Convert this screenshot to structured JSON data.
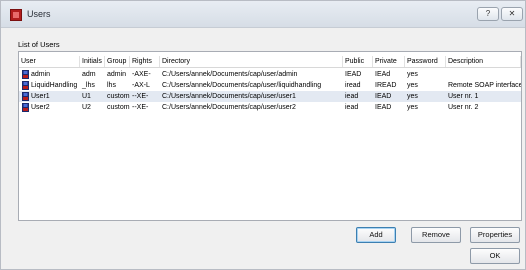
{
  "window": {
    "title": "Users",
    "help_glyph": "?",
    "close_glyph": "✕"
  },
  "list_label": "List of Users",
  "columns": [
    "User",
    "Initials",
    "Group",
    "Rights",
    "Directory",
    "Public",
    "Private",
    "Password",
    "Description"
  ],
  "rows": [
    {
      "user": "admin",
      "initials": "adm",
      "group": "admin",
      "rights": "-AXE-",
      "directory": "C:/Users/annek/Documents/cap/user/admin",
      "public": "IEAD",
      "private": "IEAd",
      "password": "yes",
      "description": ""
    },
    {
      "user": "LiquidHandling",
      "initials": "_lhs",
      "group": "lhs",
      "rights": "-AX-L",
      "directory": "C:/Users/annek/Documents/cap/user/liquidhandling",
      "public": "iread",
      "private": "IREAD",
      "password": "yes",
      "description": "Remote SOAP interface"
    },
    {
      "user": "User1",
      "initials": "U1",
      "group": "custom",
      "rights": "--XE-",
      "directory": "C:/Users/annek/Documents/cap/user/user1",
      "public": "iead",
      "private": "IEAD",
      "password": "yes",
      "description": "User nr. 1"
    },
    {
      "user": "User2",
      "initials": "U2",
      "group": "custom",
      "rights": "--XE-",
      "directory": "C:/Users/annek/Documents/cap/user/user2",
      "public": "iead",
      "private": "IEAD",
      "password": "yes",
      "description": "User nr. 2"
    }
  ],
  "selected_row": "User1",
  "buttons": {
    "add": "Add",
    "remove": "Remove",
    "properties": "Properties",
    "ok": "OK"
  },
  "icons": {
    "app": "app-icon",
    "user": "user-icon"
  },
  "colors": {
    "app_icon": "#b21d1d",
    "selection": "#e3e9f2",
    "default_button_border": "#3c7fb1"
  }
}
